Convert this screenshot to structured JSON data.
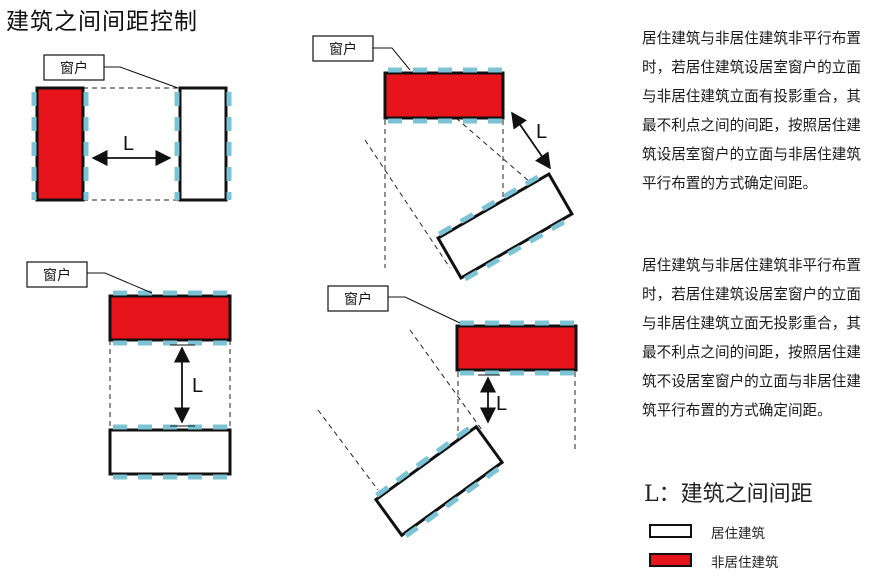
{
  "title": "建筑之间间距控制",
  "window_label": "窗户",
  "distance_label": "L",
  "descriptions": [
    "居住建筑与非居住建筑非平行布置时，若居住建筑设居室窗户的立面与非居住建筑立面有投影重合，其最不利点之间的间距，按照居住建筑设居室窗户的立面与非居住建筑平行布置的方式确定间距。",
    "居住建筑与非居住建筑非平行布置时，若居住建筑设居室窗户的立面与非居住建筑立面无投影重合，其最不利点之间的间距，按照居住建筑不设居室窗户的立面与非居住建筑平行布置的方式确定间距。"
  ],
  "legend": {
    "title": "L：建筑之间间距",
    "items": [
      {
        "label": "居住建筑",
        "fill": "#ffffff"
      },
      {
        "label": "非居住建筑",
        "fill": "#e8141c"
      }
    ]
  },
  "colors": {
    "non_residential": "#e8141c",
    "residential": "#ffffff",
    "outline": "#111111",
    "window_marks": "#7cc3d6"
  }
}
